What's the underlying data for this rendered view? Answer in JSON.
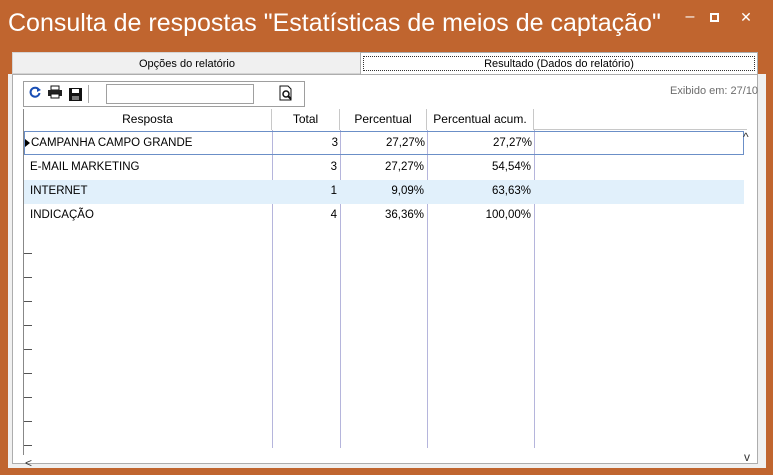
{
  "window": {
    "title": "Consulta de respostas \"Estatísticas de meios de captação\"",
    "minimize_glyph": "‒",
    "close_glyph": "✕"
  },
  "tabs": [
    {
      "label": "Opções do relatório",
      "active": false
    },
    {
      "label": "Resultado (Dados do relatório)",
      "active": true
    }
  ],
  "toolbar": {
    "refresh_icon": "refresh-icon",
    "print_icon": "printer-icon",
    "save_icon": "floppy-disk-icon",
    "search_value": "",
    "preview_icon": "print-preview-icon"
  },
  "exibido_label": "Exibido em: 27/10",
  "table": {
    "columns": [
      "Resposta",
      "Total",
      "Percentual",
      "Percentual acum."
    ],
    "rows": [
      {
        "resposta": "CAMPANHA CAMPO GRANDE",
        "total": "3",
        "percentual": "27,27%",
        "acumulado": "27,27%"
      },
      {
        "resposta": "E-MAIL MARKETING",
        "total": "3",
        "percentual": "27,27%",
        "acumulado": "54,54%"
      },
      {
        "resposta": "INTERNET",
        "total": "1",
        "percentual": "9,09%",
        "acumulado": "63,63%"
      },
      {
        "resposta": "INDICAÇÃO",
        "total": "4",
        "percentual": "36,36%",
        "acumulado": "100,00%"
      }
    ]
  },
  "colors": {
    "title_bar": "#c0652f",
    "selected_row_border": "#6b8fc7",
    "alt_row": "#e1f0fb"
  }
}
